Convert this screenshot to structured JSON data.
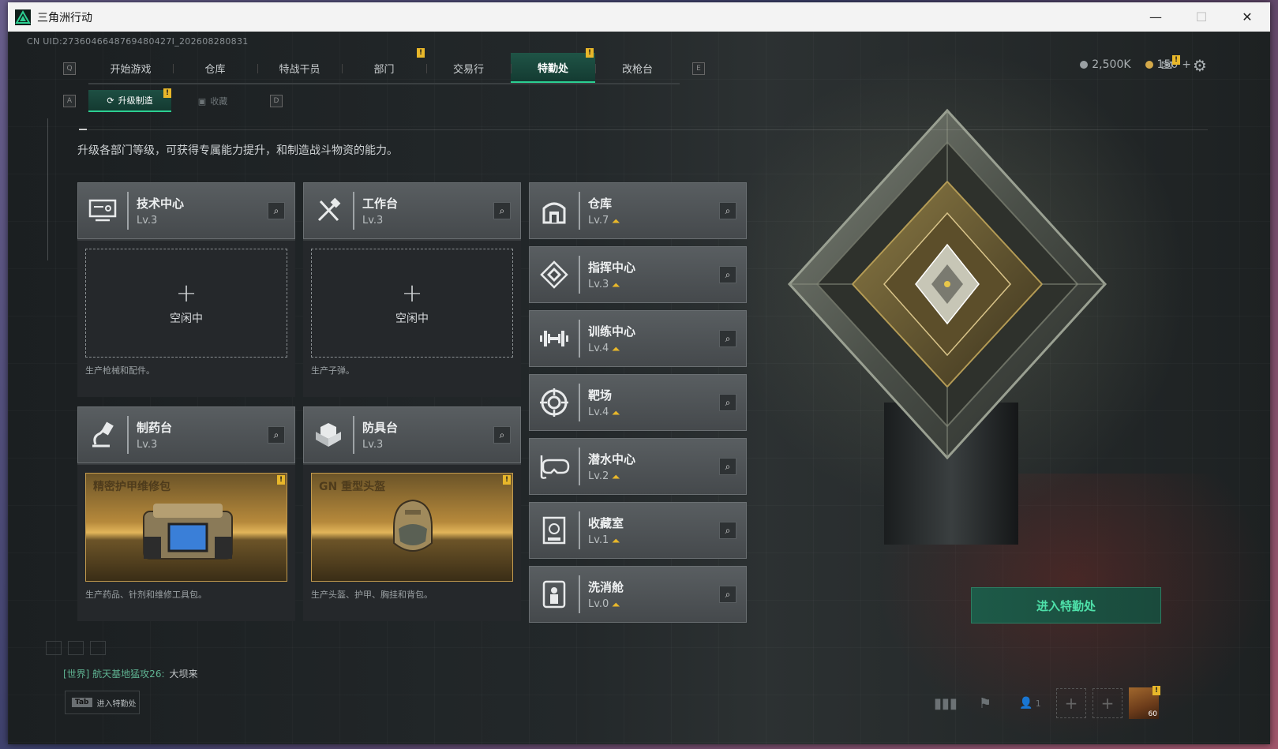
{
  "window": {
    "title": "三角洲行动",
    "controls": {
      "minimize": "—",
      "maximize": "☐",
      "close": "✕"
    }
  },
  "uid": "CN UID:2736046648769480427I_202608280831",
  "nav": {
    "key_left": "Q",
    "key_right": "E",
    "tabs": [
      {
        "label": "开始游戏",
        "badge": ""
      },
      {
        "label": "仓库",
        "badge": ""
      },
      {
        "label": "特战干员",
        "badge": ""
      },
      {
        "label": "部门",
        "badge": "!"
      },
      {
        "label": "交易行",
        "badge": ""
      },
      {
        "label": "特勤处",
        "badge": "!"
      },
      {
        "label": "改枪台",
        "badge": ""
      }
    ],
    "active_index": 5
  },
  "currency": {
    "silver": "2,500K",
    "gold": "150",
    "gold_add": "+",
    "silver_color": "#9aa0a3",
    "gold_color": "#d4a94a"
  },
  "mail_badge": "!",
  "subnav": {
    "key_left": "A",
    "key_right": "D",
    "tabs": [
      {
        "label": "升级制造",
        "badge": "!",
        "icon": "upgrade-icon"
      },
      {
        "label": "收藏",
        "badge": "",
        "icon": "collection-icon"
      }
    ]
  },
  "description": "升级各部门等级，可获得专属能力提升，和制造战斗物资的能力。",
  "production_cards": [
    {
      "name": "技术中心",
      "level": "Lv.3",
      "icon": "tech-center-icon",
      "status": "空闲中",
      "note": "生产枪械和配件。"
    },
    {
      "name": "工作台",
      "level": "Lv.3",
      "icon": "workbench-icon",
      "status": "空闲中",
      "note": "生产子弹。"
    },
    {
      "name": "制药台",
      "level": "Lv.3",
      "icon": "pharmacy-icon",
      "craft": "精密护甲维修包",
      "craft_badge": "!",
      "note": "生产药品、针剂和维修工具包。"
    },
    {
      "name": "防具台",
      "level": "Lv.3",
      "icon": "armor-bench-icon",
      "craft": "GN 重型头盔",
      "craft_badge": "!",
      "note": "生产头盔、护甲、胸挂和背包。"
    }
  ],
  "facilities": [
    {
      "name": "仓库",
      "level": "Lv.7",
      "icon": "warehouse-icon"
    },
    {
      "name": "指挥中心",
      "level": "Lv.3",
      "icon": "command-center-icon"
    },
    {
      "name": "训练中心",
      "level": "Lv.4",
      "icon": "training-center-icon"
    },
    {
      "name": "靶场",
      "level": "Lv.4",
      "icon": "shooting-range-icon"
    },
    {
      "name": "潜水中心",
      "level": "Lv.2",
      "icon": "diving-center-icon"
    },
    {
      "name": "收藏室",
      "level": "Lv.1",
      "icon": "collection-room-icon"
    },
    {
      "name": "洗消舱",
      "level": "Lv.0",
      "icon": "decontamination-icon"
    }
  ],
  "enter_button": "进入特勤处",
  "chat": {
    "channel": "[世界] 航天基地猛攻26:",
    "message": "大坝来"
  },
  "tab_hint": {
    "key": "Tab",
    "label": "进入特勤处"
  },
  "bottom_bar": {
    "friends_count": "1",
    "slot_add": "+",
    "avatar_level": "60",
    "avatar_badge": "!"
  },
  "accent_color": "#2ccf92",
  "warning_color": "#e8b72a"
}
